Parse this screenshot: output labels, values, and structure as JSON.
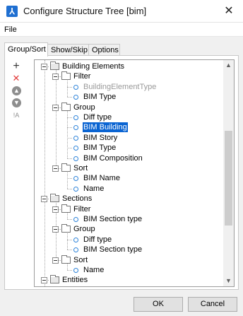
{
  "window": {
    "title": "Configure Structure Tree [bim]",
    "close_glyph": "✕",
    "icon_glyph": "⅄"
  },
  "menu": {
    "file": "File"
  },
  "tabs": [
    {
      "label": "Group/Sort",
      "active": true
    },
    {
      "label": "Show/Skip",
      "active": false
    },
    {
      "label": "Options",
      "active": false
    }
  ],
  "tools": {
    "add": "+",
    "delete": "✕",
    "up": "▲",
    "down": "▼",
    "sort": "!A"
  },
  "tree": [
    {
      "label": "Building Elements",
      "kind": "folder-open"
    },
    {
      "label": "Filter",
      "kind": "folder"
    },
    {
      "label": "BuildingElementType",
      "kind": "item",
      "greyed": true
    },
    {
      "label": "BIM Type",
      "kind": "item"
    },
    {
      "label": "Group",
      "kind": "folder"
    },
    {
      "label": "Diff type",
      "kind": "item"
    },
    {
      "label": "BIM Building",
      "kind": "item",
      "selected": true
    },
    {
      "label": "BIM Story",
      "kind": "item"
    },
    {
      "label": "BIM Type",
      "kind": "item"
    },
    {
      "label": "BIM Composition",
      "kind": "item"
    },
    {
      "label": "Sort",
      "kind": "folder"
    },
    {
      "label": "BIM Name",
      "kind": "item"
    },
    {
      "label": "Name",
      "kind": "item"
    },
    {
      "label": "Sections",
      "kind": "folder-open"
    },
    {
      "label": "Filter",
      "kind": "folder"
    },
    {
      "label": "BIM Section type",
      "kind": "item"
    },
    {
      "label": "Group",
      "kind": "folder"
    },
    {
      "label": "Diff type",
      "kind": "item"
    },
    {
      "label": "BIM Section type",
      "kind": "item"
    },
    {
      "label": "Sort",
      "kind": "folder"
    },
    {
      "label": "Name",
      "kind": "item"
    },
    {
      "label": "Entities",
      "kind": "folder-open"
    }
  ],
  "scroll": {
    "up_glyph": "▲",
    "down_glyph": "▼"
  },
  "buttons": {
    "ok": "OK",
    "cancel": "Cancel"
  },
  "colors": {
    "selection": "#0a64d2",
    "item_bullet": "#2e83d9",
    "delete": "#e23a3a"
  }
}
